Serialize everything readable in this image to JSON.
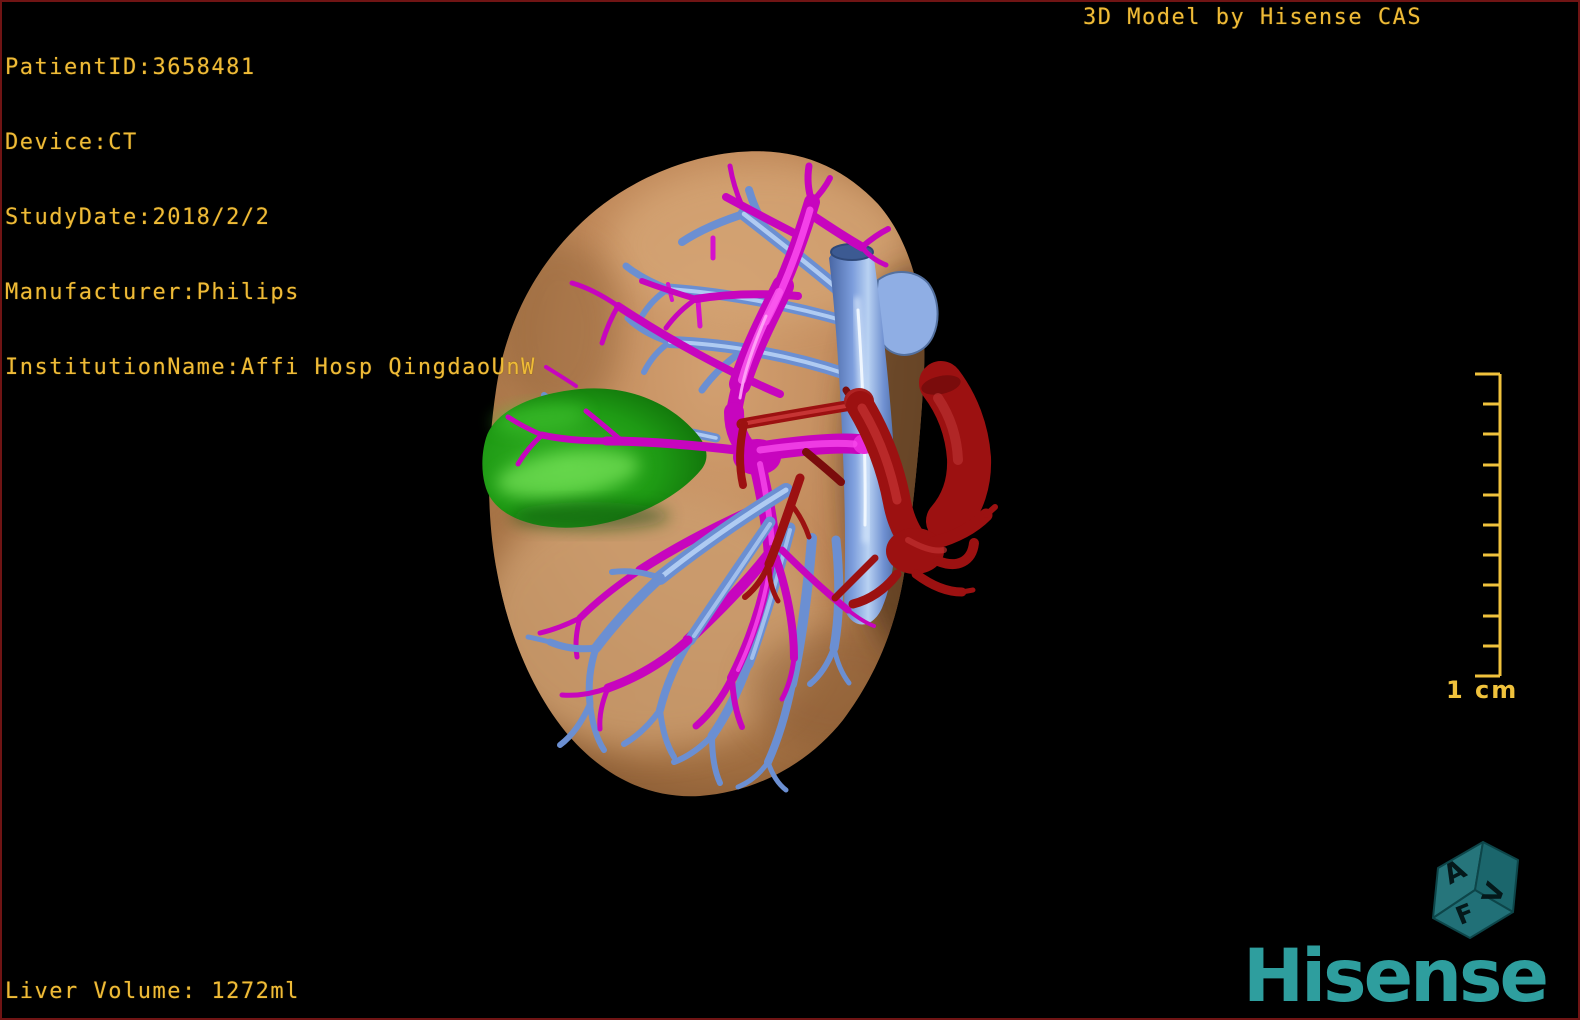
{
  "header": {
    "patient_info_lines": [
      "PatientID:3658481",
      "Device:CT",
      "StudyDate:2018/2/2",
      "Manufacturer:Philips",
      "InstitutionName:Affi Hosp QingdaoUnW"
    ],
    "watermark": "3D Model by Hisense CAS"
  },
  "footer": {
    "liver_volume": "Liver Volume: 1272ml"
  },
  "scale_bar": {
    "label": "1 cm",
    "divisions": 10
  },
  "orientation_cube": {
    "letters": {
      "left_face": "A",
      "right_face": "V",
      "bottom_face": "F"
    }
  },
  "branding": {
    "logo_text": "Hisense"
  },
  "model": {
    "structures": [
      {
        "name": "liver",
        "color": "#C18A5B"
      },
      {
        "name": "gallbladder",
        "color": "#1E9A14"
      },
      {
        "name": "portal-vein",
        "color": "#C705BE"
      },
      {
        "name": "hepatic-veins-ivc",
        "color": "#7C9DDC"
      },
      {
        "name": "hepatic-artery",
        "color": "#9C1111"
      }
    ]
  },
  "colors": {
    "text_accent": "#EFBB38",
    "brand_teal": "#2E9E9E",
    "frame_border": "#701414",
    "background": "#000000"
  }
}
